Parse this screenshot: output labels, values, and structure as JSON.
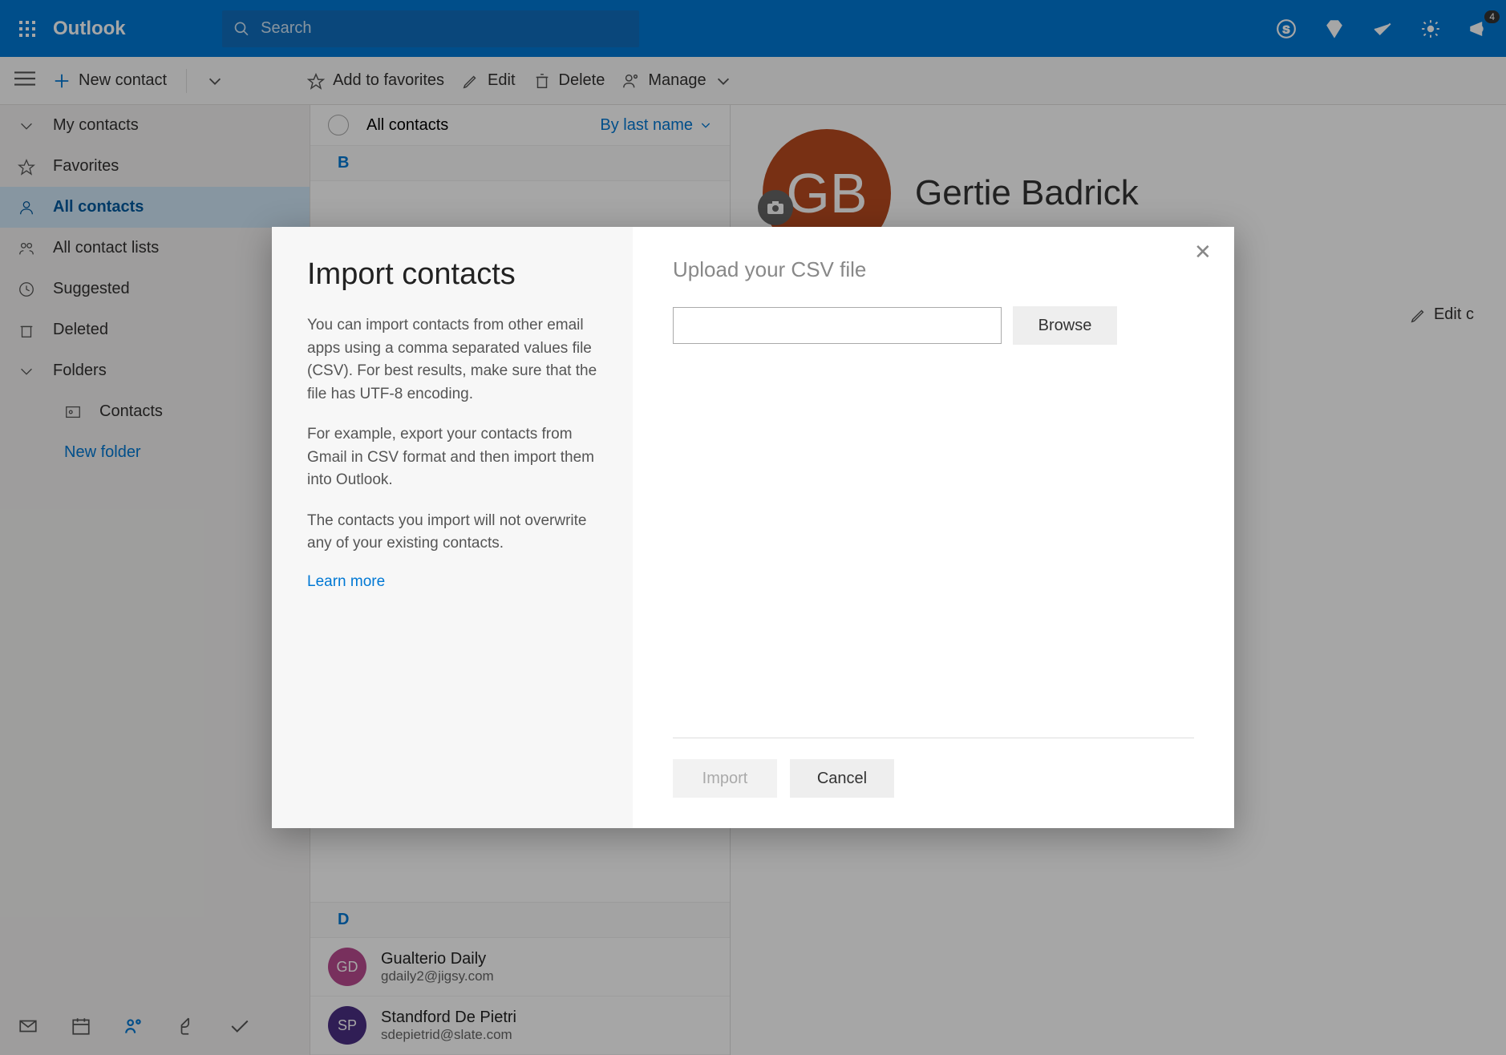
{
  "header": {
    "app_name": "Outlook",
    "search_placeholder": "Search",
    "bell_badge": "4"
  },
  "cmdbar": {
    "new_contact": "New contact",
    "add_favorites": "Add to favorites",
    "edit": "Edit",
    "delete": "Delete",
    "manage": "Manage"
  },
  "nav": {
    "my_contacts": "My contacts",
    "favorites": "Favorites",
    "all_contacts": "All contacts",
    "all_contact_lists": "All contact lists",
    "suggested": "Suggested",
    "deleted": "Deleted",
    "folders": "Folders",
    "contacts_sub": "Contacts",
    "new_folder": "New folder"
  },
  "list": {
    "header_label": "All contacts",
    "sort_label": "By last name",
    "groups": [
      {
        "letter": "B"
      },
      {
        "letter": "D",
        "rows": [
          {
            "initials": "GD",
            "color": "#b94b8f",
            "name": "Gualterio Daily",
            "email": "gdaily2@jigsy.com"
          },
          {
            "initials": "SP",
            "color": "#4b2e83",
            "name": "Standford De Pietri",
            "email": "sdepietrid@slate.com"
          }
        ]
      }
    ]
  },
  "detail": {
    "initials": "GB",
    "name": "Gertie Badrick",
    "edit_label": "Edit c"
  },
  "modal": {
    "title": "Import contacts",
    "p1": "You can import contacts from other email apps using a comma separated values file (CSV). For best results, make sure that the file has UTF-8 encoding.",
    "p2": "For example, export your contacts from Gmail in CSV format and then import them into Outlook.",
    "p3": "The contacts you import will not overwrite any of your existing contacts.",
    "learn_more": "Learn more",
    "upload_heading": "Upload your CSV file",
    "browse": "Browse",
    "import": "Import",
    "cancel": "Cancel"
  }
}
